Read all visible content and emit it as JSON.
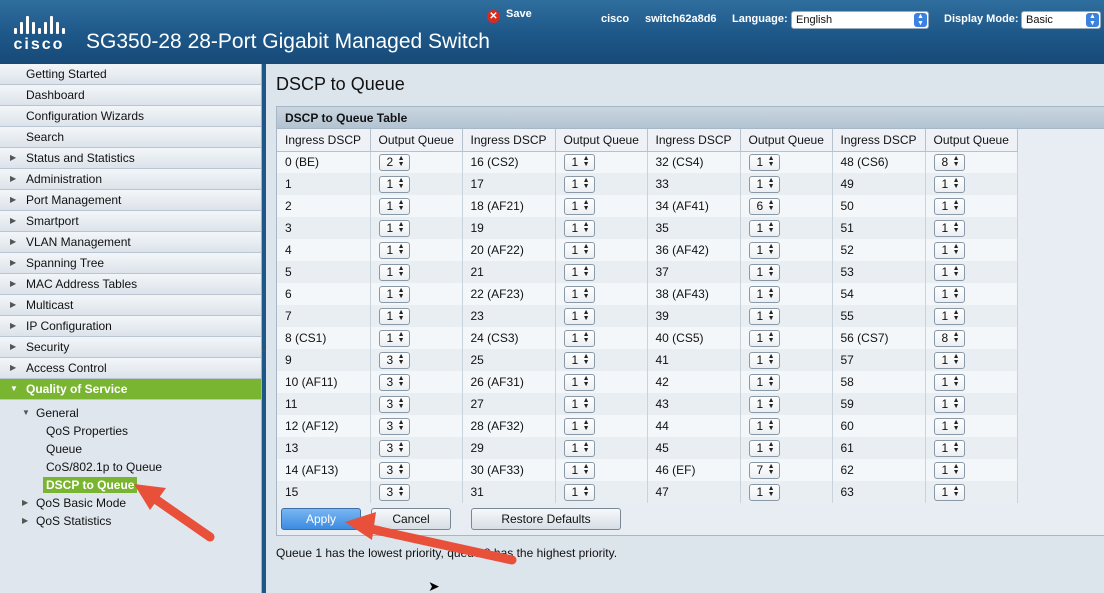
{
  "header": {
    "logo_text": "cisco",
    "title": "SG350-28 28-Port Gigabit Managed Switch",
    "save_label": "Save",
    "user": "cisco",
    "hostname": "switch62a8d6",
    "language_label": "Language:",
    "language_value": "English",
    "display_mode_label": "Display Mode:",
    "display_mode_value": "Basic"
  },
  "sidebar": {
    "items": [
      {
        "label": "Getting Started",
        "expandable": false
      },
      {
        "label": "Dashboard",
        "expandable": false
      },
      {
        "label": "Configuration Wizards",
        "expandable": false
      },
      {
        "label": "Search",
        "expandable": false
      },
      {
        "label": "Status and Statistics",
        "expandable": true
      },
      {
        "label": "Administration",
        "expandable": true
      },
      {
        "label": "Port Management",
        "expandable": true
      },
      {
        "label": "Smartport",
        "expandable": true
      },
      {
        "label": "VLAN Management",
        "expandable": true
      },
      {
        "label": "Spanning Tree",
        "expandable": true
      },
      {
        "label": "MAC Address Tables",
        "expandable": true
      },
      {
        "label": "Multicast",
        "expandable": true
      },
      {
        "label": "IP Configuration",
        "expandable": true
      },
      {
        "label": "Security",
        "expandable": true
      },
      {
        "label": "Access Control",
        "expandable": true
      },
      {
        "label": "Quality of Service",
        "expandable": true,
        "active": true
      }
    ],
    "qos_tree": {
      "general": "General",
      "general_children": [
        "QoS Properties",
        "Queue",
        "CoS/802.1p to Queue",
        "DSCP to Queue"
      ],
      "selected": "DSCP to Queue",
      "basic_mode": "QoS Basic Mode",
      "statistics": "QoS Statistics"
    }
  },
  "main": {
    "page_title": "DSCP to Queue",
    "table_title": "DSCP to Queue Table",
    "col_ingress": "Ingress DSCP",
    "col_queue": "Output Queue",
    "groups": [
      {
        "rows": [
          [
            "0 (BE)",
            "2"
          ],
          [
            "1",
            "1"
          ],
          [
            "2",
            "1"
          ],
          [
            "3",
            "1"
          ],
          [
            "4",
            "1"
          ],
          [
            "5",
            "1"
          ],
          [
            "6",
            "1"
          ],
          [
            "7",
            "1"
          ],
          [
            "8 (CS1)",
            "1"
          ],
          [
            "9",
            "3"
          ],
          [
            "10 (AF11)",
            "3"
          ],
          [
            "11",
            "3"
          ],
          [
            "12 (AF12)",
            "3"
          ],
          [
            "13",
            "3"
          ],
          [
            "14 (AF13)",
            "3"
          ],
          [
            "15",
            "3"
          ]
        ]
      },
      {
        "rows": [
          [
            "16 (CS2)",
            "1"
          ],
          [
            "17",
            "1"
          ],
          [
            "18 (AF21)",
            "1"
          ],
          [
            "19",
            "1"
          ],
          [
            "20 (AF22)",
            "1"
          ],
          [
            "21",
            "1"
          ],
          [
            "22 (AF23)",
            "1"
          ],
          [
            "23",
            "1"
          ],
          [
            "24 (CS3)",
            "1"
          ],
          [
            "25",
            "1"
          ],
          [
            "26 (AF31)",
            "1"
          ],
          [
            "27",
            "1"
          ],
          [
            "28 (AF32)",
            "1"
          ],
          [
            "29",
            "1"
          ],
          [
            "30 (AF33)",
            "1"
          ],
          [
            "31",
            "1"
          ]
        ]
      },
      {
        "rows": [
          [
            "32 (CS4)",
            "1"
          ],
          [
            "33",
            "1"
          ],
          [
            "34 (AF41)",
            "6"
          ],
          [
            "35",
            "1"
          ],
          [
            "36 (AF42)",
            "1"
          ],
          [
            "37",
            "1"
          ],
          [
            "38 (AF43)",
            "1"
          ],
          [
            "39",
            "1"
          ],
          [
            "40 (CS5)",
            "1"
          ],
          [
            "41",
            "1"
          ],
          [
            "42",
            "1"
          ],
          [
            "43",
            "1"
          ],
          [
            "44",
            "1"
          ],
          [
            "45",
            "1"
          ],
          [
            "46 (EF)",
            "7"
          ],
          [
            "47",
            "1"
          ]
        ]
      },
      {
        "rows": [
          [
            "48 (CS6)",
            "8"
          ],
          [
            "49",
            "1"
          ],
          [
            "50",
            "1"
          ],
          [
            "51",
            "1"
          ],
          [
            "52",
            "1"
          ],
          [
            "53",
            "1"
          ],
          [
            "54",
            "1"
          ],
          [
            "55",
            "1"
          ],
          [
            "56 (CS7)",
            "8"
          ],
          [
            "57",
            "1"
          ],
          [
            "58",
            "1"
          ],
          [
            "59",
            "1"
          ],
          [
            "60",
            "1"
          ],
          [
            "61",
            "1"
          ],
          [
            "62",
            "1"
          ],
          [
            "63",
            "1"
          ]
        ]
      }
    ],
    "buttons": {
      "apply": "Apply",
      "cancel": "Cancel",
      "restore": "Restore Defaults"
    },
    "note": "Queue 1 has the lowest priority, queue 8 has the highest priority."
  },
  "colors": {
    "header": "#1d5788",
    "active_nav": "#7ab532",
    "annotation_arrow": "#e8503a",
    "apply_button": "#3d8be0"
  }
}
